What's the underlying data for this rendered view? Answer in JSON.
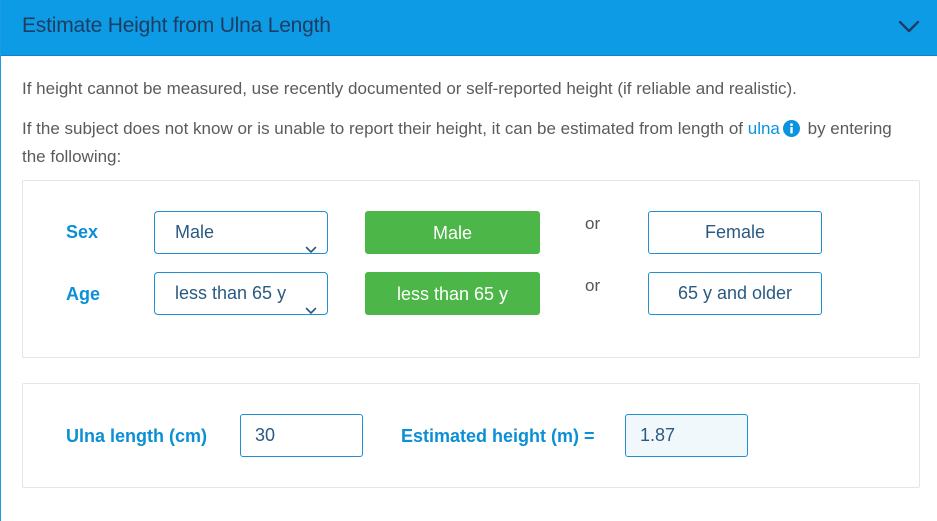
{
  "header": {
    "title": "Estimate Height from Ulna Length",
    "icon": "chevron-down-icon"
  },
  "intro": {
    "line1": "If height cannot be measured, use recently documented or self-reported height (if reliable and realistic).",
    "line2_before": "If the subject does not know or is unable to report their height, it can be estimated from length of ",
    "link": "ulna",
    "line2_after": " by entering the following:"
  },
  "sex": {
    "label": "Sex",
    "selected": "Male",
    "option_a": "Male",
    "or": "or",
    "option_b": "Female"
  },
  "age": {
    "label": "Age",
    "selected": "less than 65 y",
    "option_a": "less than 65 y",
    "or": "or",
    "option_b": "65 y and older"
  },
  "ulna": {
    "label": "Ulna length (cm)",
    "value": "30"
  },
  "result": {
    "label": "Estimated height (m) =",
    "value": "1.87"
  },
  "colors": {
    "header_bg": "#0d9be6",
    "accent": "#0b8fd6",
    "selected_green": "#4cb748"
  }
}
